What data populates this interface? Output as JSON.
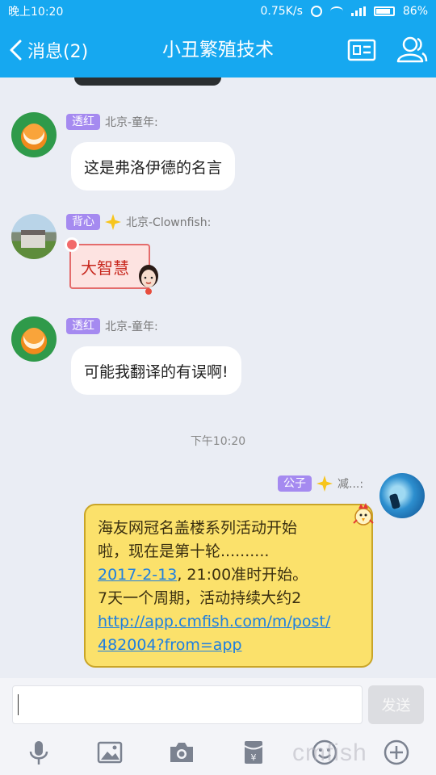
{
  "statusbar": {
    "time": "晚上10:20",
    "speed": "0.75K/s",
    "battery": "86%",
    "battery_level": 0.86
  },
  "header": {
    "back_label": "消息(2)",
    "title": "小丑繁殖技术"
  },
  "messages": [
    {
      "badge": "透红",
      "sender": "北京-童年:",
      "text": "这是弗洛伊德的名言"
    },
    {
      "badge": "背心",
      "sender": "北京-Clownfish:",
      "sticker_text": "大智慧"
    },
    {
      "badge": "透红",
      "sender": "北京-童年:",
      "text": "可能我翻译的有误啊!"
    }
  ],
  "timestamp": "下午10:20",
  "own_message": {
    "badge": "公子",
    "sender": "减...:",
    "line1": "海友网冠名盖楼系列活动开始",
    "line2": "啦，现在是第十轮..........",
    "date_link": "2017-2-13",
    "line3_rest": ", 21:00准时开始。",
    "line4": "7天一个周期，活动持续大约2",
    "url_line1": "http://app.cmfish.com/m/post/",
    "url_line2": "482004?from=app"
  },
  "composer": {
    "send_label": "发送",
    "placeholder": ""
  },
  "watermark": "cmfish",
  "icons": [
    "back-chevron-icon",
    "profile-card-icon",
    "group-members-icon",
    "voice-icon",
    "image-icon",
    "camera-icon",
    "red-packet-icon",
    "emoji-icon",
    "plus-icon"
  ],
  "colors": {
    "accent": "#16a8f0",
    "badge": "#a58af0",
    "yellow_bubble": "#fbe16b",
    "link": "#1e7fe0"
  }
}
